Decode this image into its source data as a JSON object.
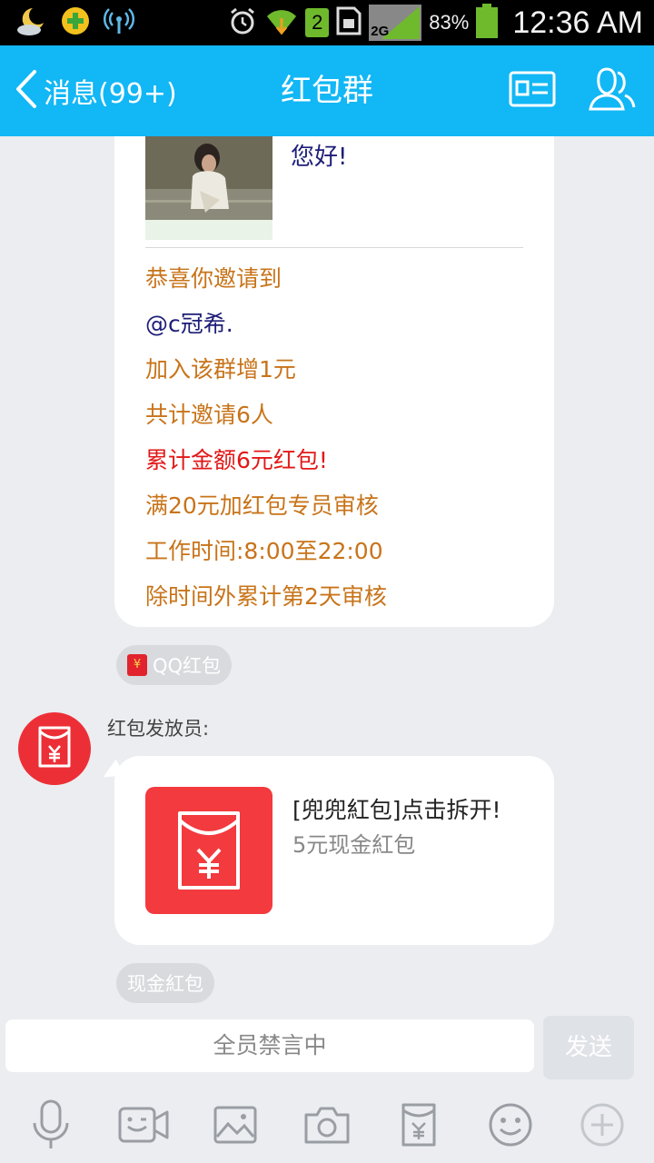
{
  "status_bar": {
    "network": "2G",
    "sim": "2",
    "battery": "83%",
    "time": "12:36 AM",
    "icons": [
      "weather-moon-icon",
      "add-app-icon",
      "hotspot-icon",
      "alarm-icon",
      "wifi-icon",
      "sim-icon",
      "sd-card-icon",
      "signal-icon",
      "battery-icon"
    ]
  },
  "header": {
    "back_label": "消息(99+)",
    "title": "红包群",
    "icons": [
      "chevron-left-icon",
      "profile-card-icon",
      "group-members-icon"
    ],
    "color": "#12b7f5"
  },
  "message1": {
    "greeting": "您好!",
    "lines": [
      {
        "text": "恭喜你邀请到",
        "color": "#c8741a"
      },
      {
        "text": "@c冠希.",
        "color": "#1d1d78"
      },
      {
        "text": "加入该群增1元",
        "color": "#c8741a"
      },
      {
        "text": "共计邀请6人",
        "color": "#c8741a"
      },
      {
        "text": "累计金额6元红包!",
        "color": "#e21818"
      },
      {
        "text": "满20元加红包专员审核",
        "color": "#c8741a"
      },
      {
        "text": "工作时间:8:00至22:00",
        "color": "#c8741a"
      },
      {
        "text": "除时间外累计第2天审核",
        "color": "#c8741a"
      }
    ]
  },
  "tag1": {
    "label": "QQ红包",
    "icon": "red-envelope-icon"
  },
  "message2": {
    "sender": "红包发放员:",
    "title": "[兜兜紅包]点击拆开!",
    "subtitle": "5元现金紅包",
    "icon": "red-envelope-yuan-icon"
  },
  "tag2": {
    "label": "现金紅包"
  },
  "input": {
    "placeholder": "全员禁言中",
    "send_label": "发送"
  },
  "toolbar": {
    "items": [
      "microphone-icon",
      "video-call-icon",
      "image-icon",
      "camera-icon",
      "red-envelope-icon",
      "emoji-icon",
      "plus-icon"
    ]
  }
}
